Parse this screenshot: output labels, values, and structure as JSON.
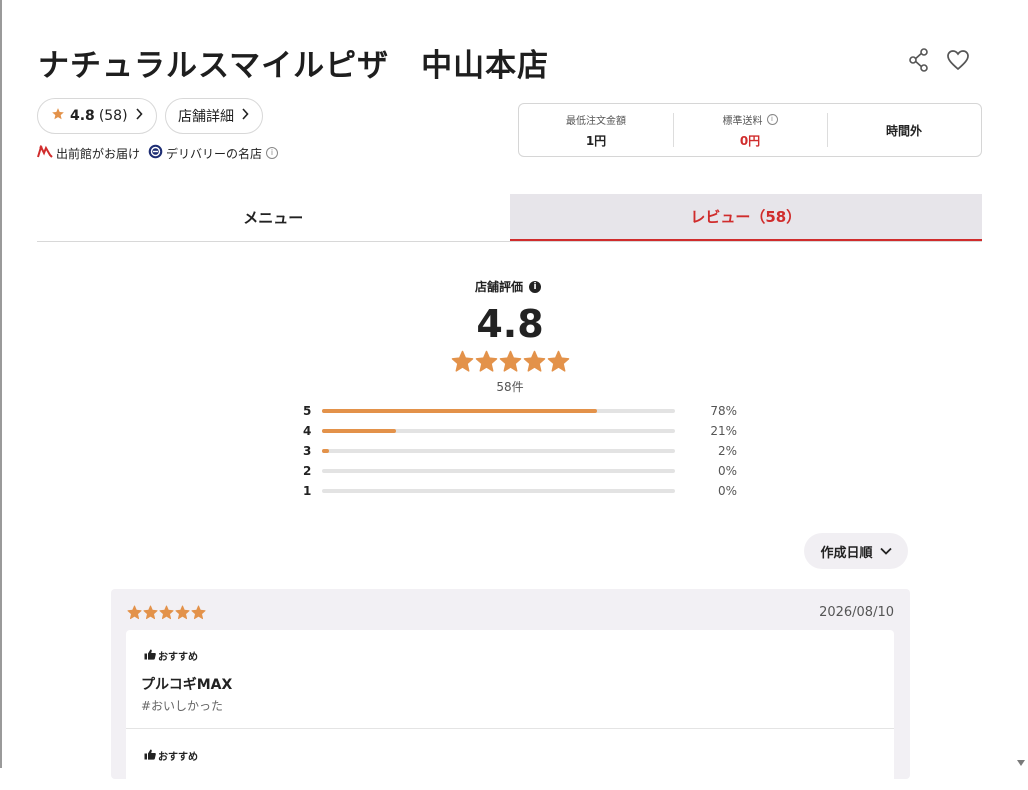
{
  "store": {
    "title": "ナチュラルスマイルピザ　中山本店",
    "rating": "4.8",
    "rating_count": "(58)",
    "details_label": "店舗詳細",
    "badges": [
      "出前館がお届け",
      "デリバリーの名店"
    ]
  },
  "info": {
    "min_order_label": "最低注文金額",
    "min_order_value": "1円",
    "delivery_fee_label": "標準送料",
    "delivery_fee_value": "0円",
    "hours_status": "時間外"
  },
  "tabs": {
    "menu": "メニュー",
    "reviews": "レビュー（58）"
  },
  "review_summary": {
    "heading": "店舗評価",
    "score": "4.8",
    "count_label": "58件",
    "stars": 4.8,
    "distribution": [
      {
        "stars": "5",
        "percent": 78,
        "label": "78%"
      },
      {
        "stars": "4",
        "percent": 21,
        "label": "21%"
      },
      {
        "stars": "3",
        "percent": 2,
        "label": "2%"
      },
      {
        "stars": "2",
        "percent": 0,
        "label": "0%"
      },
      {
        "stars": "1",
        "percent": 0,
        "label": "0%"
      }
    ]
  },
  "sort": {
    "label": "作成日順"
  },
  "review": {
    "rating": 5,
    "date": "2026/08/10",
    "recommend_label": "おすすめ",
    "item_name": "プルコギMAX",
    "item_tag": "#おいしかった",
    "next_recommend_label": "おすすめ"
  },
  "colors": {
    "accent_red": "#d02c2c",
    "star_orange": "#e3924a",
    "active_tab_bg": "#e7e5ea"
  }
}
